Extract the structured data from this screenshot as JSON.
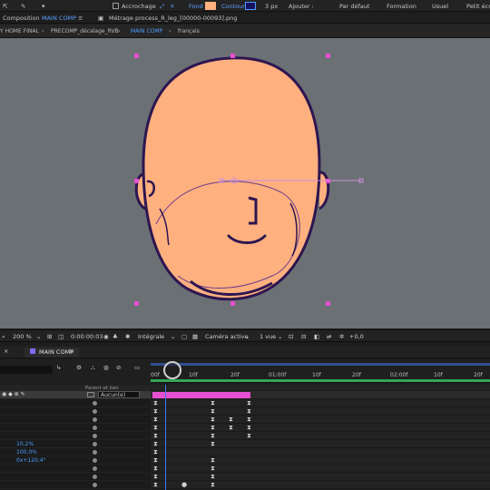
{
  "toolbar": {
    "snapping_label": "Accrochage",
    "fill_label": "Fond",
    "stroke_label": "Contour",
    "stroke_width": "3 px",
    "add_label": "Ajouter :",
    "default_label": "Par défaut",
    "training_label": "Formation",
    "usual_label": "Usuel",
    "small_screen_label": "Petit écra",
    "fill_color": "#ffb07f",
    "stroke_color": "#1a1060"
  },
  "panel_bar": {
    "composition_label": "Composition",
    "comp_name": "MAIN COMP",
    "footage_label": "Métrage process_R_leg_[00000-00093].png"
  },
  "breadcrumbs": {
    "items": [
      "Y HOME FINAL",
      "PRECOMP_décalage_RVB",
      "MAIN COMP",
      "français"
    ]
  },
  "viewer_controls": {
    "zoom": "200 %",
    "timecode": "0:00:00:03",
    "resolution": "Intégrale",
    "camera": "Caméra active",
    "views": "1 vue",
    "exposure": "+0,0"
  },
  "timeline": {
    "tab_label": "MAIN COMP",
    "ruler_labels": [
      "10f",
      "20f",
      "01:00f",
      "10f",
      "20f",
      "02:00f",
      "10f",
      "20f"
    ],
    "start_label": "00f",
    "parent_header": "Parent et lien",
    "parent_value": "Aucun(e)",
    "property_values": [
      "10,2%",
      "100,0%",
      "0x+120,4°"
    ]
  },
  "colors": {
    "accent": "#4d9bff",
    "face": "#ffb07f",
    "outline": "#2d1650",
    "layer_bar": "#e64fd0",
    "viewer_bg": "#6b7075",
    "handle": "#e64fd0"
  }
}
